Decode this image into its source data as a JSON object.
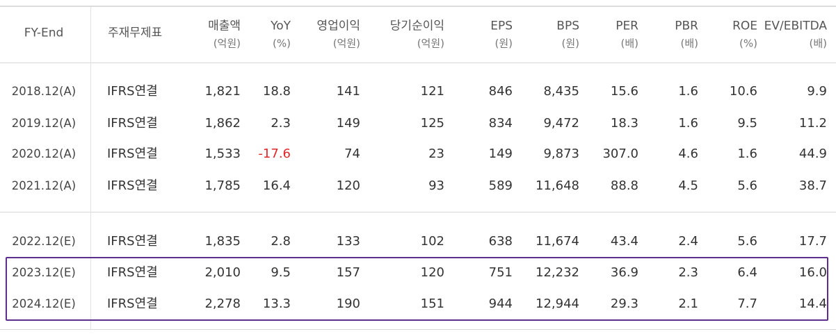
{
  "table": {
    "headers": [
      {
        "key": "fy",
        "line1": "FY-End",
        "line2": ""
      },
      {
        "key": "type",
        "line1": "주재무제표",
        "line2": ""
      },
      {
        "key": "sales",
        "line1": "매출액",
        "line2": "(억원)"
      },
      {
        "key": "yoy",
        "line1": "YoY",
        "line2": "(%)"
      },
      {
        "key": "op",
        "line1": "영업이익",
        "line2": "(억원)"
      },
      {
        "key": "net",
        "line1": "당기순이익",
        "line2": "(억원)"
      },
      {
        "key": "eps",
        "line1": "EPS",
        "line2": "(원)"
      },
      {
        "key": "bps",
        "line1": "BPS",
        "line2": "(원)"
      },
      {
        "key": "per",
        "line1": "PER",
        "line2": "(배)"
      },
      {
        "key": "pbr",
        "line1": "PBR",
        "line2": "(배)"
      },
      {
        "key": "roe",
        "line1": "ROE",
        "line2": "(%)"
      },
      {
        "key": "ev",
        "line1": "EV/EBITDA",
        "line2": "(배)"
      }
    ],
    "rows": [
      [
        "2018.12(A)",
        "IFRS연결",
        "1,821",
        "18.8",
        "141",
        "121",
        "846",
        "8,435",
        "15.6",
        "1.6",
        "10.6",
        "9.9"
      ],
      [
        "2019.12(A)",
        "IFRS연결",
        "1,862",
        "2.3",
        "149",
        "125",
        "834",
        "9,472",
        "18.3",
        "1.6",
        "9.5",
        "11.2"
      ],
      [
        "2020.12(A)",
        "IFRS연결",
        "1,533",
        "-17.6",
        "74",
        "23",
        "149",
        "9,873",
        "307.0",
        "4.6",
        "1.6",
        "44.9"
      ],
      [
        "2021.12(A)",
        "IFRS연결",
        "1,785",
        "16.4",
        "120",
        "93",
        "589",
        "11,648",
        "88.8",
        "4.5",
        "5.6",
        "38.7"
      ],
      [
        "2022.12(E)",
        "IFRS연결",
        "1,835",
        "2.8",
        "133",
        "102",
        "638",
        "11,674",
        "43.4",
        "2.4",
        "5.6",
        "17.7"
      ],
      [
        "2023.12(E)",
        "IFRS연결",
        "2,010",
        "9.5",
        "157",
        "120",
        "751",
        "12,232",
        "36.9",
        "2.3",
        "6.4",
        "16.0"
      ],
      [
        "2024.12(E)",
        "IFRS연결",
        "2,278",
        "13.3",
        "190",
        "151",
        "944",
        "12,944",
        "29.3",
        "2.1",
        "7.7",
        "14.4"
      ]
    ],
    "highlighted_rows": [
      5,
      6
    ],
    "colors": {
      "negative": "#e0282a",
      "highlight_border": "#5b2d8e"
    }
  }
}
